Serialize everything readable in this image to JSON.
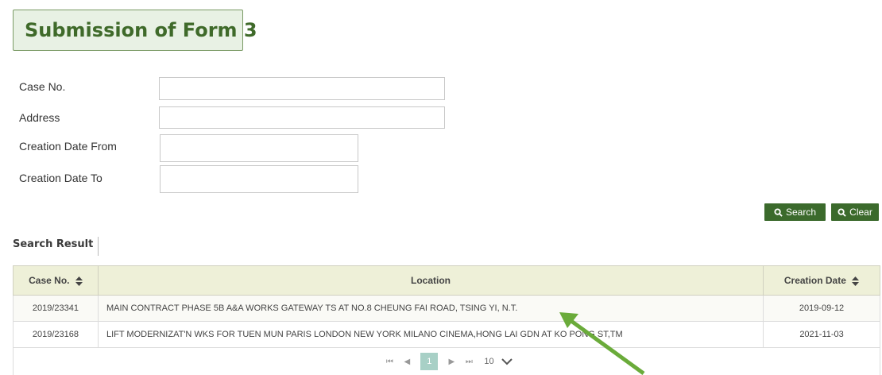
{
  "page": {
    "title": "Submission of Form 3"
  },
  "form": {
    "case_no": {
      "label": "Case No.",
      "value": ""
    },
    "address": {
      "label": "Address",
      "value": ""
    },
    "creation_date_from": {
      "label": "Creation Date From",
      "value": ""
    },
    "creation_date_to": {
      "label": "Creation Date To",
      "value": ""
    }
  },
  "buttons": {
    "search": "Search",
    "clear": "Clear"
  },
  "results": {
    "label": "Search Result",
    "columns": [
      "Case No.",
      "Location",
      "Creation Date"
    ],
    "rows": [
      {
        "case_no": "2019/23341",
        "location": "MAIN CONTRACT PHASE 5B A&A WORKS GATEWAY TS AT NO.8 CHEUNG FAI ROAD, TSING YI, N.T.",
        "date": "2019-09-12"
      },
      {
        "case_no": "2019/23168",
        "location": "LIFT MODERNIZAT'N WKS FOR TUEN MUN PARIS LONDON NEW YORK MILANO CINEMA,HONG LAI GDN AT KO PONG ST,TM",
        "date": "2021-11-03"
      }
    ]
  },
  "pagination": {
    "current_page": "1",
    "page_size": "10"
  },
  "colors": {
    "accent": "#3b6a2c",
    "title_bg": "#e8f1e4",
    "header_bg": "#eef0d8",
    "arrow": "#6aab3a"
  }
}
